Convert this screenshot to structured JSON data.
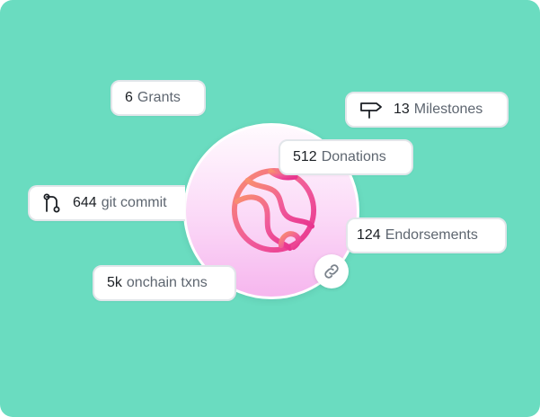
{
  "colors": {
    "background": "#6adcc0",
    "pill_border": "#e2e6ea",
    "number": "#1b1f24",
    "label": "#5e6670",
    "globe_gradient": [
      "#f98f6f",
      "#f05a9a",
      "#e8348f"
    ]
  },
  "stats": {
    "grants": {
      "number": "6",
      "label": "Grants"
    },
    "milestones": {
      "number": "13",
      "label": "Milestones",
      "icon": "signpost-icon"
    },
    "donations": {
      "number": "512",
      "label": "Donations"
    },
    "git": {
      "number": "644",
      "label": "git commit",
      "icon": "git-branch-icon"
    },
    "endorsements": {
      "number": "124",
      "label": "Endorsements"
    },
    "txns": {
      "number": "5k",
      "label": "onchain txns"
    }
  },
  "center": {
    "logo_icon": "globe-icon",
    "badge_icon": "link-icon"
  }
}
